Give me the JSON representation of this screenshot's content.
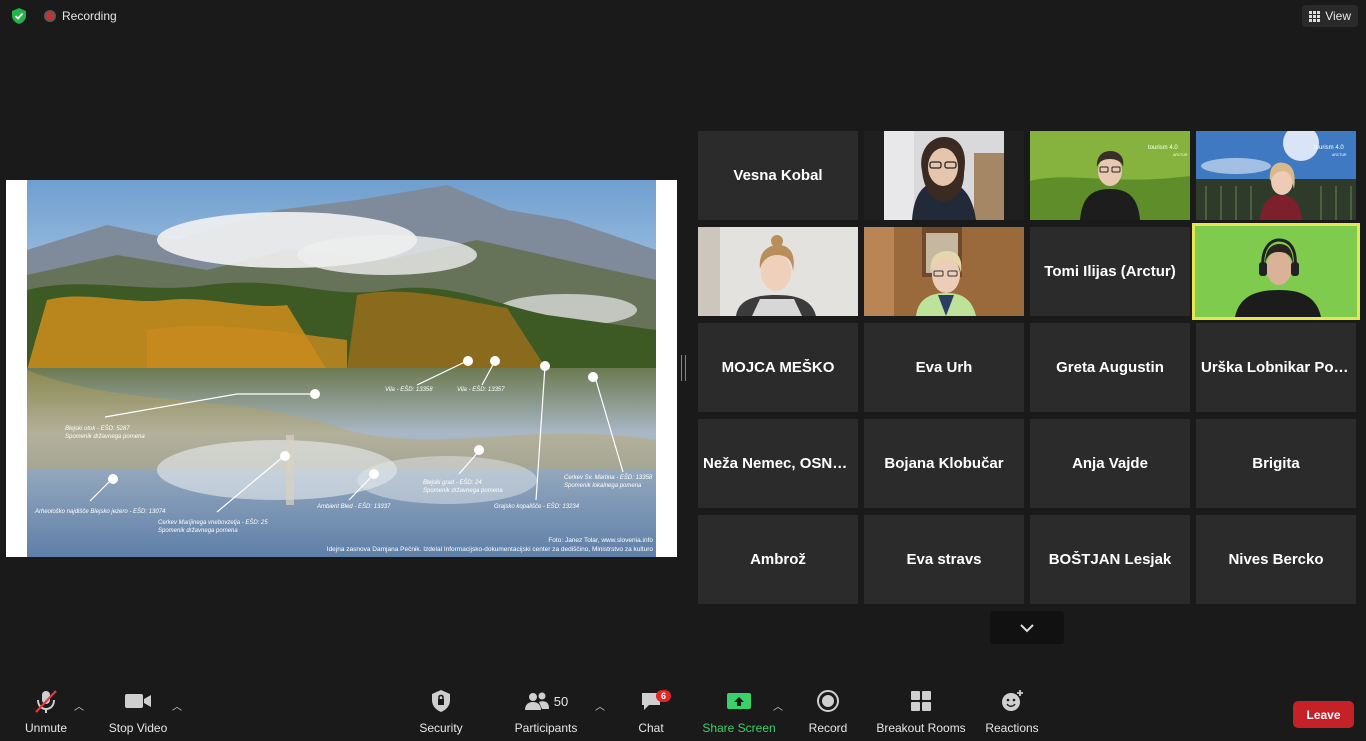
{
  "topbar": {
    "recording_label": "Recording",
    "view_label": "View"
  },
  "shared_screen": {
    "annotations": [
      {
        "l1": "Blejski otok - EŠD: 5287",
        "l2": "Spomenik državnega pomena"
      },
      {
        "l1": "Vila - EŠD: 13358",
        "l2": ""
      },
      {
        "l1": "Vila - EŠD: 13357",
        "l2": ""
      },
      {
        "l1": "Arheološko najdišče Blejsko jezero - EŠD: 13074",
        "l2": ""
      },
      {
        "l1": "Cerkev Marijinega vnebovzetja - EŠD: 25",
        "l2": "Spomenik državnega pomena"
      },
      {
        "l1": "Ambient Bled - EŠD: 13337",
        "l2": ""
      },
      {
        "l1": "Blejski grad - EŠD: 24",
        "l2": "Spomenik državnega pomena"
      },
      {
        "l1": "Grajsko kopališče - EŠD: 13234",
        "l2": ""
      },
      {
        "l1": "Cerkev Sv. Martina - EŠD: 13358",
        "l2": "Spomenik lokalnega pomena"
      }
    ],
    "credit_1": "Foto: Janez Tolar, www.slovenia.info",
    "credit_2": "Idejna zasnova Damjana Pečnik. Izdelal Informacijsko-dokumentacijski center za dediščino, Ministrstvo za kulturo"
  },
  "participants": [
    {
      "name": "Vesna Kobal",
      "video": false
    },
    {
      "name": "",
      "video": true
    },
    {
      "name": "",
      "video": true
    },
    {
      "name": "",
      "video": true
    },
    {
      "name": "",
      "video": true
    },
    {
      "name": "",
      "video": true
    },
    {
      "name": "Tomi Ilijas (Arctur)",
      "video": false
    },
    {
      "name": "",
      "video": true
    },
    {
      "name": "MOJCA MEŠKO",
      "video": false
    },
    {
      "name": "Eva Urh",
      "video": false
    },
    {
      "name": "Greta Augustin",
      "video": false
    },
    {
      "name": "Urška  Lobnikar Podbevšek",
      "video": false
    },
    {
      "name": "Neža  Nemec, OSNOVNA",
      "video": false
    },
    {
      "name": "Bojana Klobučar",
      "video": false
    },
    {
      "name": "Anja Vajde",
      "video": false
    },
    {
      "name": "Brigita",
      "video": false
    },
    {
      "name": "Ambrož",
      "video": false
    },
    {
      "name": "Eva stravs",
      "video": false
    },
    {
      "name": "BOŠTJAN Lesjak",
      "video": false
    },
    {
      "name": "Nives Bercko",
      "video": false
    }
  ],
  "video_overlays": {
    "tourism_logo": "tourism 4.0",
    "arctur_logo": "ARCTUR"
  },
  "toolbar": {
    "unmute": "Unmute",
    "stop_video": "Stop Video",
    "security": "Security",
    "participants": "Participants",
    "participants_count": "50",
    "chat": "Chat",
    "chat_badge": "6",
    "share_screen": "Share Screen",
    "record": "Record",
    "breakout_rooms": "Breakout Rooms",
    "reactions": "Reactions",
    "leave": "Leave"
  },
  "colors": {
    "share_green": "#39d169",
    "leave_red": "#c52127",
    "active_speaker": "#e8e64f"
  }
}
